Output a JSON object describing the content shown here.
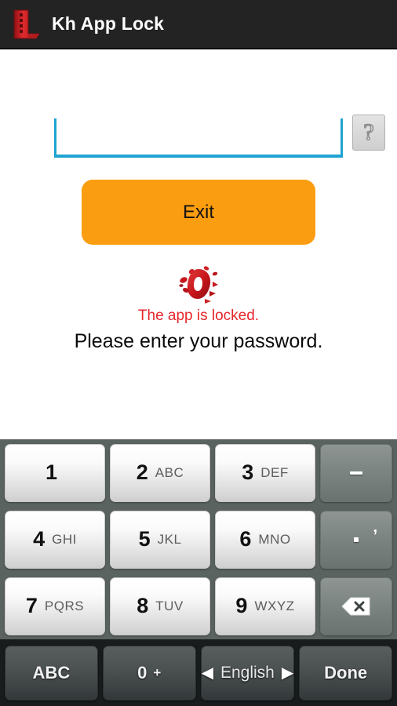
{
  "titlebar": {
    "app_name": "Kh App Lock",
    "icon": "app-lock-l-logo-icon",
    "bg_color": "#232323",
    "icon_color": "#cc1f22"
  },
  "form": {
    "password_field": {
      "value": "",
      "placeholder": "",
      "underline_color": "#1ea3d2"
    },
    "help_button": {
      "label": "?",
      "icon": "question-mark-icon"
    },
    "exit_button": {
      "label": "Exit",
      "bg_color": "#fb9d10",
      "text_color": "#141414"
    },
    "lock_icon": "broken-lock-splatter-icon",
    "locked_message": "The app is locked.",
    "locked_message_color": "#e6262c",
    "prompt_message": "Please enter your password."
  },
  "keyboard": {
    "bg_color": "#5b6361",
    "rows": [
      {
        "keys": [
          {
            "digit": "1",
            "letters": ""
          },
          {
            "digit": "2",
            "letters": "ABC"
          },
          {
            "digit": "3",
            "letters": "DEF"
          }
        ],
        "side": {
          "name": "dash-key",
          "label": "-"
        }
      },
      {
        "keys": [
          {
            "digit": "4",
            "letters": "GHI"
          },
          {
            "digit": "5",
            "letters": "JKL"
          },
          {
            "digit": "6",
            "letters": "MNO"
          }
        ],
        "side": {
          "name": "punctuation-key",
          "label": ".",
          "secondary": ","
        }
      },
      {
        "keys": [
          {
            "digit": "7",
            "letters": "PQRS"
          },
          {
            "digit": "8",
            "letters": "TUV"
          },
          {
            "digit": "9",
            "letters": "WXYZ"
          }
        ],
        "side": {
          "name": "backspace-key",
          "label": "backspace-icon"
        }
      }
    ],
    "bottom_row": {
      "abc_label": "ABC",
      "zero_label": "0",
      "zero_secondary": "+",
      "prev_lang_arrow": "◀",
      "language_label": "English",
      "next_lang_arrow": "▶",
      "done_label": "Done"
    }
  }
}
